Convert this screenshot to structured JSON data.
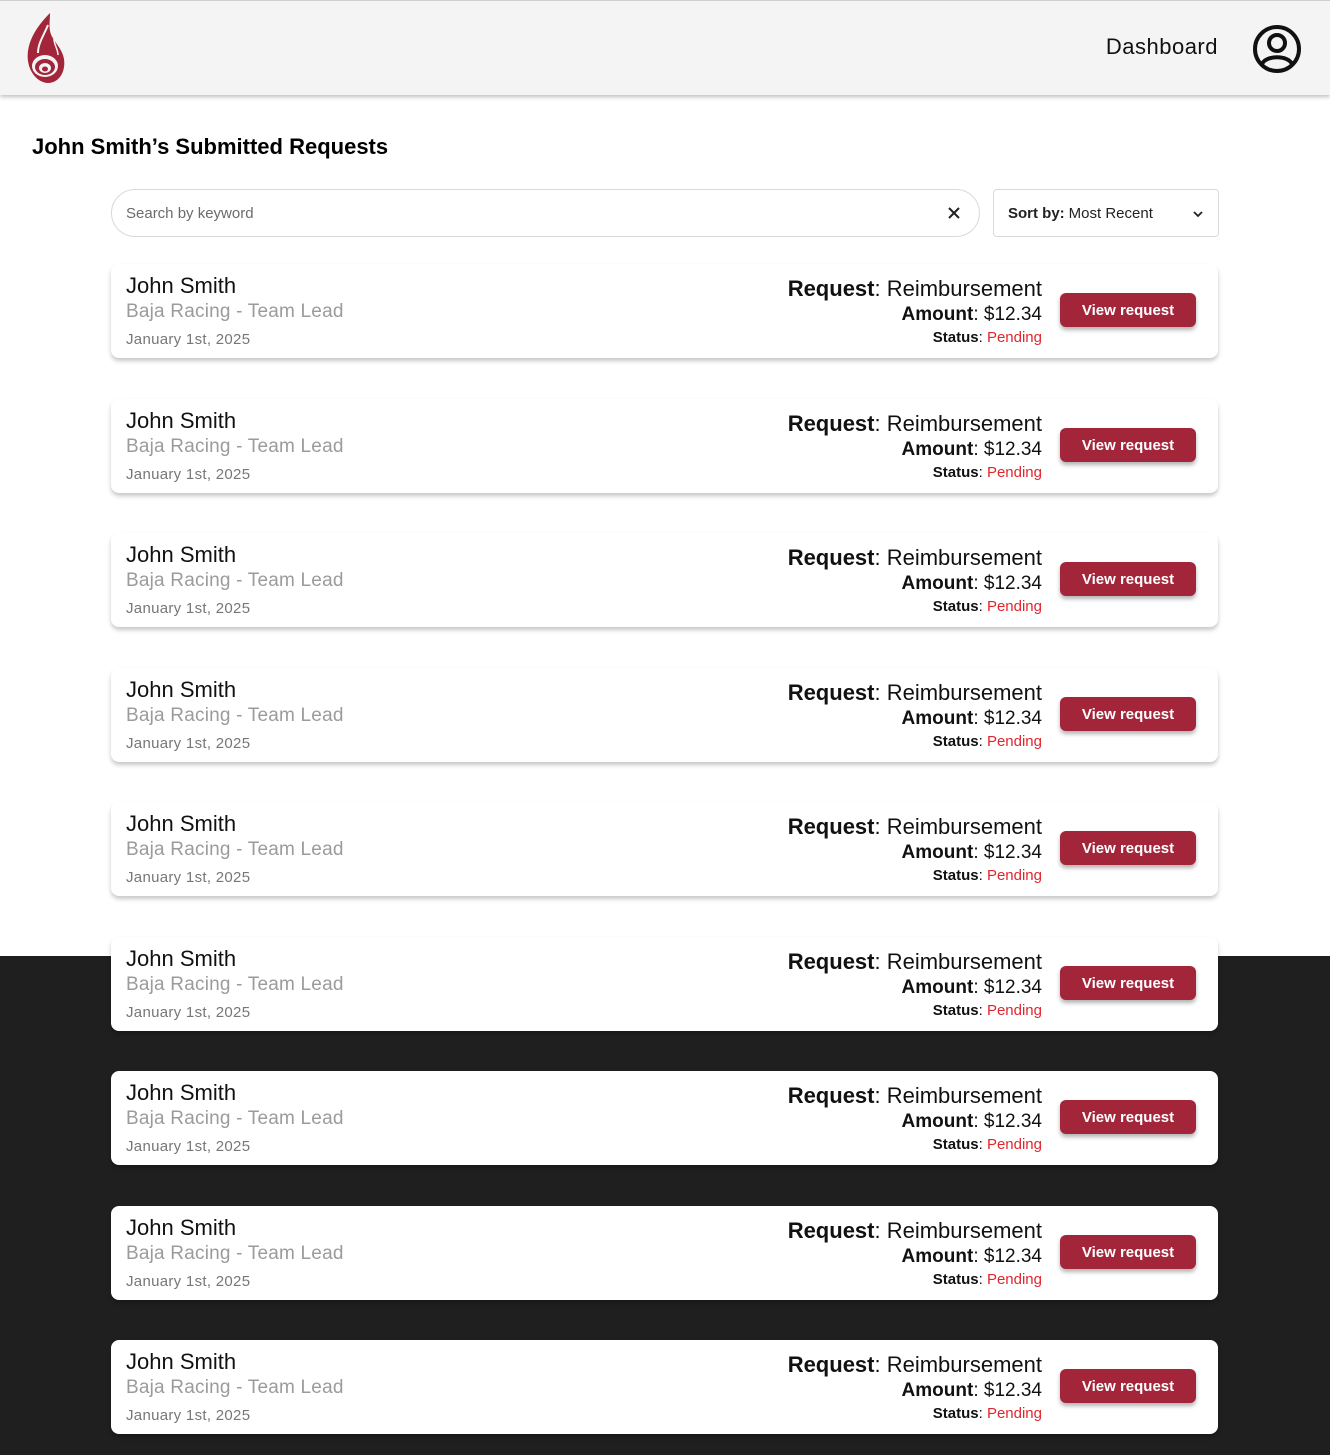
{
  "header": {
    "nav_label": "Dashboard",
    "logo_icon": "flame-logo",
    "profile_icon": "user-circle-icon",
    "brand_color": "#a3253a"
  },
  "page": {
    "title": "John Smith’s Submitted Requests"
  },
  "search": {
    "placeholder": "Search by keyword",
    "value": "",
    "clear_icon": "close-icon"
  },
  "sort": {
    "label": "Sort by:",
    "value": "Most Recent",
    "icon": "chevron-down-icon"
  },
  "requests": [
    {
      "name": "John Smith",
      "org": "Baja Racing - Team Lead",
      "date": "January 1st, 2025",
      "request_label": "Request",
      "request_type": "Reimbursement",
      "amount_label": "Amount",
      "amount": "$12.34",
      "status_label": "Status",
      "status": "Pending",
      "button": "View request"
    },
    {
      "name": "John Smith",
      "org": "Baja Racing - Team Lead",
      "date": "January 1st, 2025",
      "request_label": "Request",
      "request_type": "Reimbursement",
      "amount_label": "Amount",
      "amount": "$12.34",
      "status_label": "Status",
      "status": "Pending",
      "button": "View request"
    },
    {
      "name": "John Smith",
      "org": "Baja Racing - Team Lead",
      "date": "January 1st, 2025",
      "request_label": "Request",
      "request_type": "Reimbursement",
      "amount_label": "Amount",
      "amount": "$12.34",
      "status_label": "Status",
      "status": "Pending",
      "button": "View request"
    },
    {
      "name": "John Smith",
      "org": "Baja Racing - Team Lead",
      "date": "January 1st, 2025",
      "request_label": "Request",
      "request_type": "Reimbursement",
      "amount_label": "Amount",
      "amount": "$12.34",
      "status_label": "Status",
      "status": "Pending",
      "button": "View request"
    },
    {
      "name": "John Smith",
      "org": "Baja Racing - Team Lead",
      "date": "January 1st, 2025",
      "request_label": "Request",
      "request_type": "Reimbursement",
      "amount_label": "Amount",
      "amount": "$12.34",
      "status_label": "Status",
      "status": "Pending",
      "button": "View request"
    },
    {
      "name": "John Smith",
      "org": "Baja Racing - Team Lead",
      "date": "January 1st, 2025",
      "request_label": "Request",
      "request_type": "Reimbursement",
      "amount_label": "Amount",
      "amount": "$12.34",
      "status_label": "Status",
      "status": "Pending",
      "button": "View request"
    },
    {
      "name": "John Smith",
      "org": "Baja Racing - Team Lead",
      "date": "January 1st, 2025",
      "request_label": "Request",
      "request_type": "Reimbursement",
      "amount_label": "Amount",
      "amount": "$12.34",
      "status_label": "Status",
      "status": "Pending",
      "button": "View request"
    },
    {
      "name": "John Smith",
      "org": "Baja Racing - Team Lead",
      "date": "January 1st, 2025",
      "request_label": "Request",
      "request_type": "Reimbursement",
      "amount_label": "Amount",
      "amount": "$12.34",
      "status_label": "Status",
      "status": "Pending",
      "button": "View request"
    },
    {
      "name": "John Smith",
      "org": "Baja Racing - Team Lead",
      "date": "January 1st, 2025",
      "request_label": "Request",
      "request_type": "Reimbursement",
      "amount_label": "Amount",
      "amount": "$12.34",
      "status_label": "Status",
      "status": "Pending",
      "button": "View request"
    }
  ]
}
